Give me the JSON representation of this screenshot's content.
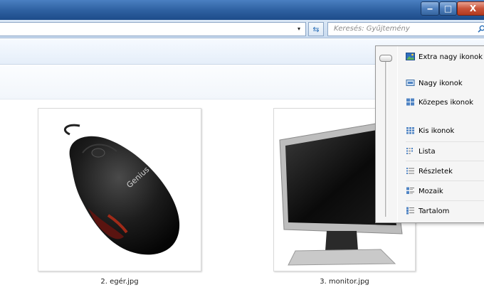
{
  "window": {
    "minimize_glyph": "‒",
    "maximize_glyph": "□",
    "close_glyph": "X"
  },
  "address": {
    "dropdown_glyph": "▾",
    "refresh_glyph": "⇆"
  },
  "search": {
    "placeholder": "Keresés: Gyűjtemény",
    "icon": "search-icon"
  },
  "files": [
    {
      "name": "2. egér.jpg",
      "kind": "mouse-image"
    },
    {
      "name": "3. monitor.jpg",
      "kind": "monitor-image"
    }
  ],
  "view_menu": {
    "items": [
      {
        "label": "Extra nagy ikonok",
        "icon": "extra-large-icons-icon"
      },
      {
        "label": "Nagy ikonok",
        "icon": "large-icons-icon"
      },
      {
        "label": "Közepes ikonok",
        "icon": "medium-icons-icon"
      },
      {
        "label": "Kis ikonok",
        "icon": "small-icons-icon"
      },
      {
        "label": "Lista",
        "icon": "list-icon"
      },
      {
        "label": "Részletek",
        "icon": "details-icon"
      },
      {
        "label": "Mozaik",
        "icon": "tiles-icon"
      },
      {
        "label": "Tartalom",
        "icon": "content-icon"
      }
    ],
    "selected_index": 0
  }
}
